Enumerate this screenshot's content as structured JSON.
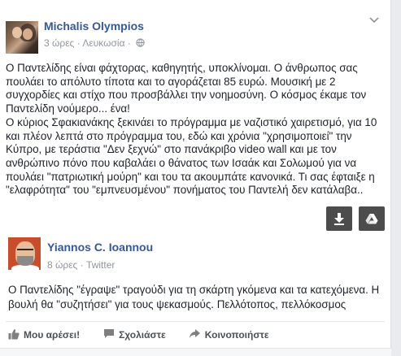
{
  "post": {
    "author": "Michalis Olympios",
    "time": "3 ώρες",
    "location": "Λευκωσία",
    "separator": "·",
    "paragraphs": [
      "Ο Παντελίδης είναι φάχτορας, καθηγητής, υποκλίνομαι. Ο άνθρωπος σας πουλάει το απόλυτο τίποτα και το αγοράζεται 85 ευρώ. Μουσική με 2 συγχορδίες και στίχο που προσβάλλει την νοημοσύνη. Ο κόσμος έκαμε τον Παντελίδη νούμερο... ένα!",
      "Ο κύριος Σφακιανάκης ξεκινάει το πρόγραμμα με ναζιστικό χαιρετισμό, για 10 και πλέον λεπτά στο πρόγραμμα του, εδώ και χρόνια \"χρησιμοποιεί\" την Κύπρο, με τεράστια \"Δεν ξεχνώ\" στο πανάκριβο video wall και με τον ανθρώπινο πόνο που καβαλάει ο θάνατος των Ισαάκ και Σολωμού για να πουλάει \"πατριωτική μούρη\" και του τα ακουμπάτε κανονικά. Τι σας έφταιξε η \"ελαφρότητα\" του \"εμπνευσμένου\" πονήματος του Παντελή δεν κατάλαβα.."
    ]
  },
  "shared": {
    "author": "Yiannos C. Ioannou",
    "time": "8 ώρες",
    "source": "Twitter",
    "separator": "·",
    "text": "Ο Παντελίδης \"έγραψε\" τραγούδι για τη σκάρτη γκόμενα και τα κατεχόμενα. Η βουλή θα \"συζητήσει\" για τους ψεκασμούς. Πελλότοπος, πελλόκοσμος"
  },
  "actions": {
    "like": "Μου αρέσει!",
    "comment": "Σχολιάστε",
    "share": "Κοινοποιήστε"
  },
  "icons": {
    "menu": "chevron-down-icon",
    "privacy": "globe-icon",
    "download": "download-arrow-icon",
    "drive": "google-drive-icon",
    "like": "thumbs-up-icon",
    "comment": "speech-bubble-icon",
    "share": "share-arrow-icon"
  },
  "colors": {
    "author_link": "#365899",
    "text": "#1d2129",
    "meta": "#90949c",
    "action": "#4b4f56",
    "background": "#e9ebee"
  }
}
